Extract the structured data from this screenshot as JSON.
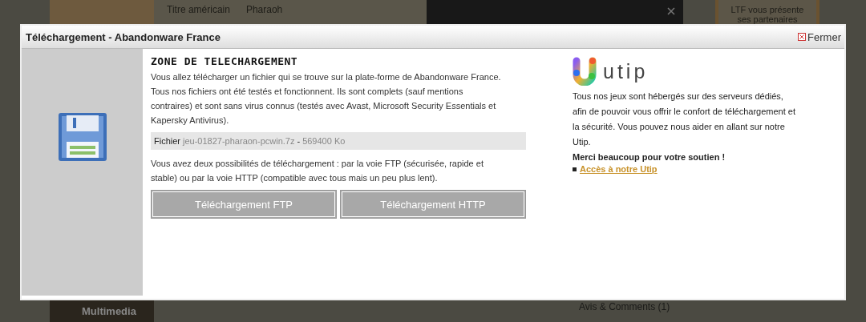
{
  "background": {
    "info_label": "Titre américain",
    "info_value": "Pharaoh",
    "partners": "LTF vous présente ses partenaires",
    "category": "Multimedia",
    "links": [
      "Avis & Comments (1)"
    ]
  },
  "dialog": {
    "title": "Téléchargement - Abandonware France",
    "close_label": "Fermer",
    "heading": "ZONE DE TELECHARGEMENT",
    "intro": "Vous allez télécharger un fichier qui se trouve sur la plate-forme de Abandonware France. Tous nos fichiers ont été testés et fonctionnent. Ils sont complets (sauf mentions contraires) et sont sans virus connus (testés avec Avast, Microsoft Security Essentials et Kapersky Antivirus).",
    "file_label": "Fichier",
    "file_name": "jeu-01827-pharaon-pcwin.7z",
    "file_separator": "-",
    "file_size": "569400 Ko",
    "choice_text": "Vous avez deux possibilités de téléchargement : par la voie FTP (sécurisée, rapide et stable) ou par la voie HTTP (compatible avec tous mais un peu plus lent).",
    "buttons": [
      "Téléchargement FTP",
      "Téléchargement HTTP"
    ],
    "sponsor": {
      "name": "utip",
      "text": "Tous nos jeux sont hébergés sur des serveurs dédiés, afin de pouvoir vous offrir le confort de téléchargement et la sécurité. Vous pouvez nous aider en allant sur notre Utip.",
      "thanks": "Merci beaucoup pour votre soutien !",
      "link": "Accès à notre Utip"
    }
  }
}
